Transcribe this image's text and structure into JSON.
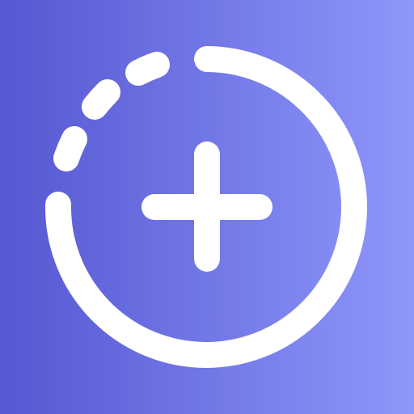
{
  "app_icon": {
    "icon": "add-story-icon",
    "glyph_color": "#ffffff",
    "gradient": {
      "from": "#5657d1",
      "to": "#8e97fb"
    }
  }
}
